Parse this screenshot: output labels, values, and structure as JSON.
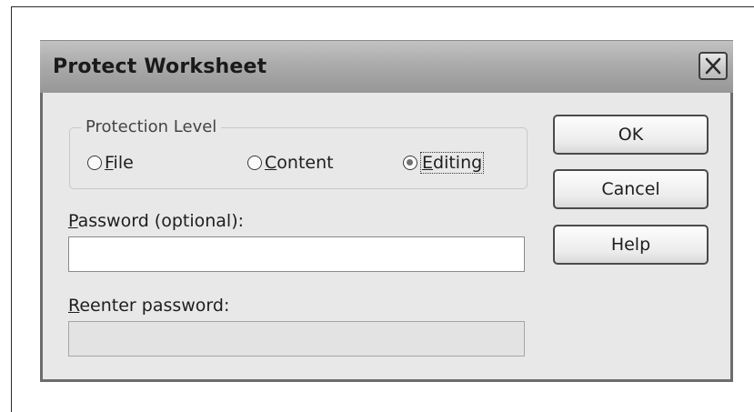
{
  "dialog": {
    "title": "Protect Worksheet",
    "close_icon": "close-icon"
  },
  "protection_level": {
    "legend": "Protection Level",
    "options": [
      {
        "label_first": "F",
        "label_rest": "ile",
        "selected": false
      },
      {
        "label_first": "C",
        "label_rest": "ontent",
        "selected": false
      },
      {
        "label_first": "E",
        "label_rest": "diting",
        "selected": true
      }
    ]
  },
  "password": {
    "label_first": "P",
    "label_rest": "assword (optional):",
    "value": ""
  },
  "reenter": {
    "label_first": "R",
    "label_rest": "eenter password:",
    "value": "",
    "disabled": true
  },
  "buttons": {
    "ok": "OK",
    "cancel": "Cancel",
    "help": "Help"
  }
}
